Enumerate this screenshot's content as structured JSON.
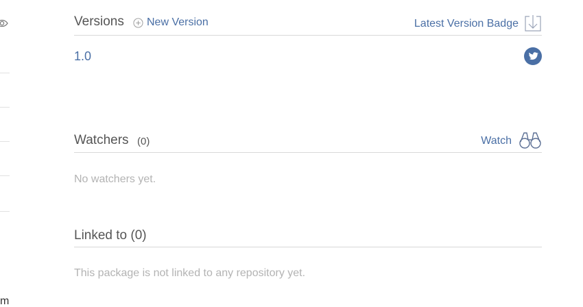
{
  "sidebar": {
    "partial_text": "m"
  },
  "versions": {
    "title": "Versions",
    "new_version_label": "New Version",
    "badge_label": "Latest Version Badge",
    "items": [
      {
        "version": "1.0"
      }
    ]
  },
  "watchers": {
    "title": "Watchers",
    "count": "(0)",
    "watch_label": "Watch",
    "empty_text": "No watchers yet."
  },
  "linked": {
    "title": "Linked to (0)",
    "empty_text": "This package is not linked to any repository yet."
  },
  "colors": {
    "link": "#4a6fa5",
    "muted": "#b3b3b3",
    "divider": "#d8d8d8",
    "twitter": "#4a6fa5"
  }
}
